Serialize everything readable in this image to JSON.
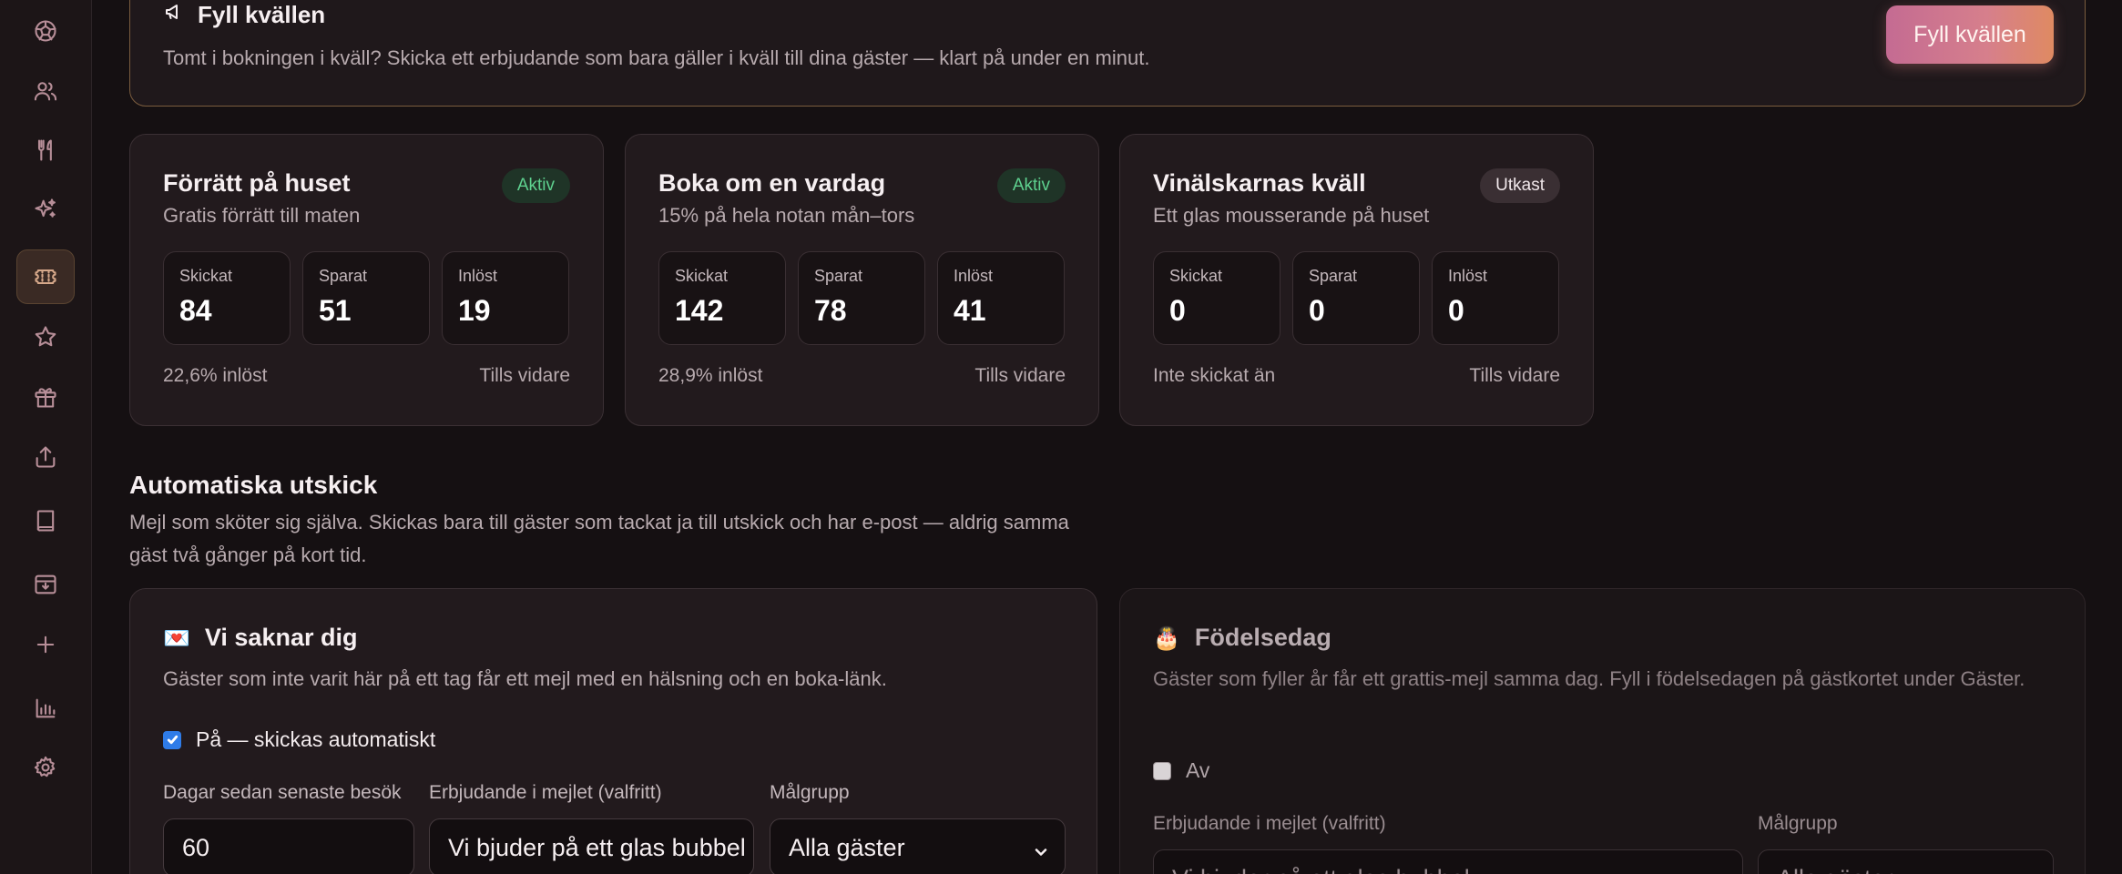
{
  "banner": {
    "title": "Fyll kvällen",
    "icon": "megaphone-icon",
    "description": "Tomt i bokningen i kväll? Skicka ett erbjudande som bara gäller i kväll till dina gäster — klart på under en minut.",
    "button_label": "Fyll kvällen"
  },
  "offers": [
    {
      "title": "Förrätt på huset",
      "subtitle": "Gratis förrätt till maten",
      "badge": "Aktiv",
      "stats": [
        {
          "label": "Skickat",
          "value": "84"
        },
        {
          "label": "Sparat",
          "value": "51"
        },
        {
          "label": "Inlöst",
          "value": "19"
        }
      ],
      "foot_left": "22,6% inlöst",
      "foot_right": "Tills vidare"
    },
    {
      "title": "Boka om en vardag",
      "subtitle": "15% på hela notan mån–tors",
      "badge": "Aktiv",
      "stats": [
        {
          "label": "Skickat",
          "value": "142"
        },
        {
          "label": "Sparat",
          "value": "78"
        },
        {
          "label": "Inlöst",
          "value": "41"
        }
      ],
      "foot_left": "28,9% inlöst",
      "foot_right": "Tills vidare"
    },
    {
      "title": "Vinälskarnas kväll",
      "subtitle": "Ett glas mousserande på huset",
      "badge": "Utkast",
      "stats": [
        {
          "label": "Skickat",
          "value": "0"
        },
        {
          "label": "Sparat",
          "value": "0"
        },
        {
          "label": "Inlöst",
          "value": "0"
        }
      ],
      "foot_left": "Inte skickat än",
      "foot_right": "Tills vidare"
    }
  ],
  "section": {
    "title": "Automatiska utskick",
    "description": "Mejl som sköter sig själva. Skickas bara till gäster som tackat ja till utskick och har e-post — aldrig samma gäst två gånger på kort tid."
  },
  "auto": [
    {
      "emoji": "💌",
      "title": "Vi saknar dig",
      "description": "Gäster som inte varit här på ett tag får ett mejl med en hälsning och en boka-länk.",
      "toggle_label": "På — skickas automatiskt",
      "days_label": "Dagar sedan senaste besök",
      "days_value": "60",
      "offer_label": "Erbjudande i mejlet (valfritt)",
      "offer_value": "Vi bjuder på ett glas bubbel",
      "audience_label": "Målgrupp",
      "audience_value": "Alla gäster"
    },
    {
      "emoji": "🎂",
      "title": "Födelsedag",
      "description": "Gäster som fyller år får ett grattis-mejl samma dag. Fyll i födelsedagen på gästkortet under Gäster.",
      "toggle_label": "Av",
      "offer_label": "Erbjudande i mejlet (valfritt)",
      "offer_value": "Vi bjuder på ett glas bubbel",
      "audience_label": "Målgrupp",
      "audience_value": "Alla gäster"
    }
  ],
  "sidebar_icons": [
    "dashboard-icon",
    "guests-icon",
    "menu-icon",
    "sparkle-icon",
    "offers-icon",
    "star-icon",
    "gift-icon",
    "export-icon",
    "book-icon",
    "archive-icon",
    "add-icon",
    "stats-icon",
    "settings-icon"
  ]
}
